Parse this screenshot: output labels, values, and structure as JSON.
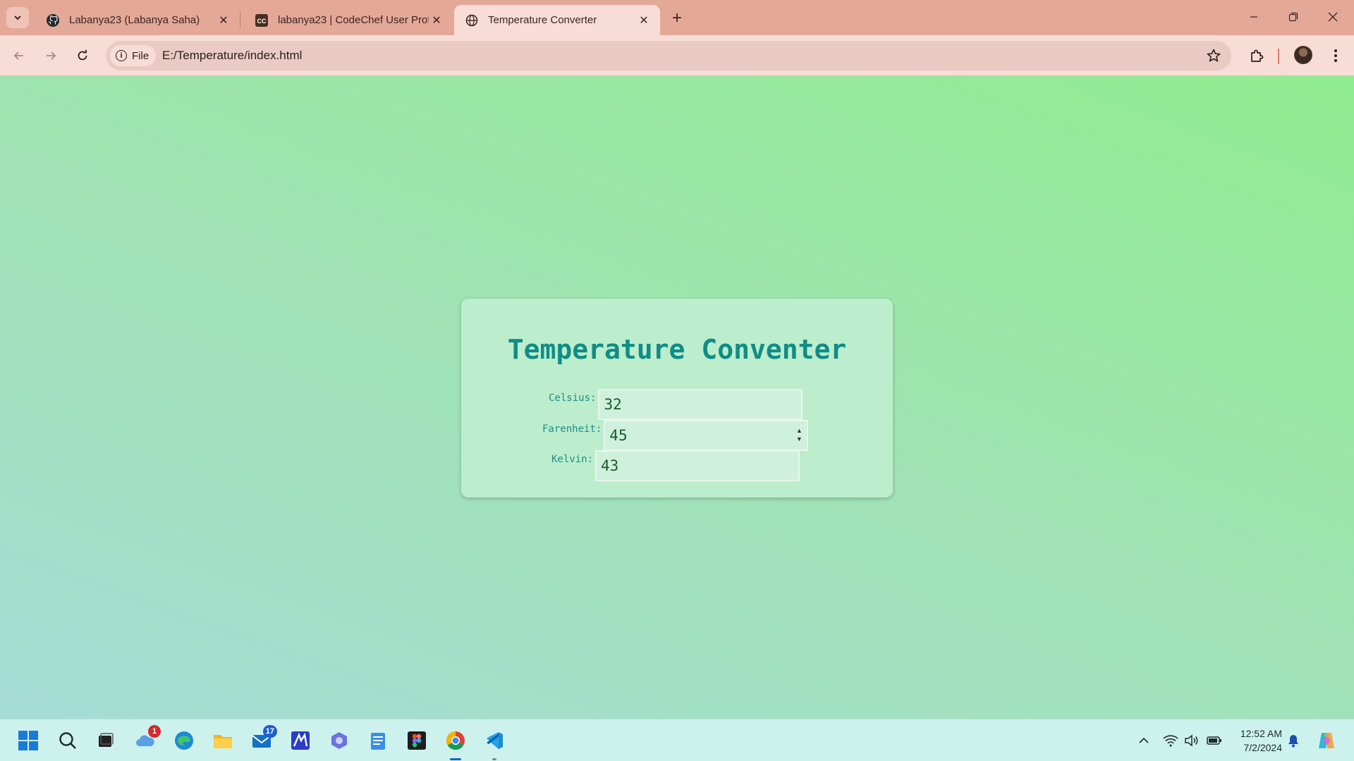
{
  "browser": {
    "tabs": [
      {
        "title": "Labanya23 (Labanya Saha)",
        "icon": "github-icon"
      },
      {
        "title": "labanya23 | CodeChef User Prof",
        "icon": "codechef-icon"
      },
      {
        "title": "Temperature Converter",
        "icon": "globe-icon",
        "active": true
      }
    ],
    "chip_label": "File",
    "url": "E:/Temperature/index.html"
  },
  "page": {
    "title": "Temperature Conventer",
    "fields": {
      "celsius": {
        "label": "Celsius:",
        "value": "32"
      },
      "farenheit": {
        "label": "Farenheit:",
        "value": "45"
      },
      "kelvin": {
        "label": "Kelvin:",
        "value": "43"
      }
    }
  },
  "taskbar": {
    "weather_badge": "1",
    "mail_badge": "17",
    "time": "12:52 AM",
    "date": "7/2/2024"
  },
  "colors": {
    "tabbar": "#e4a899",
    "toolbar": "#f7ddd6",
    "title": "#0f8d86",
    "card": "#bcedcc"
  }
}
